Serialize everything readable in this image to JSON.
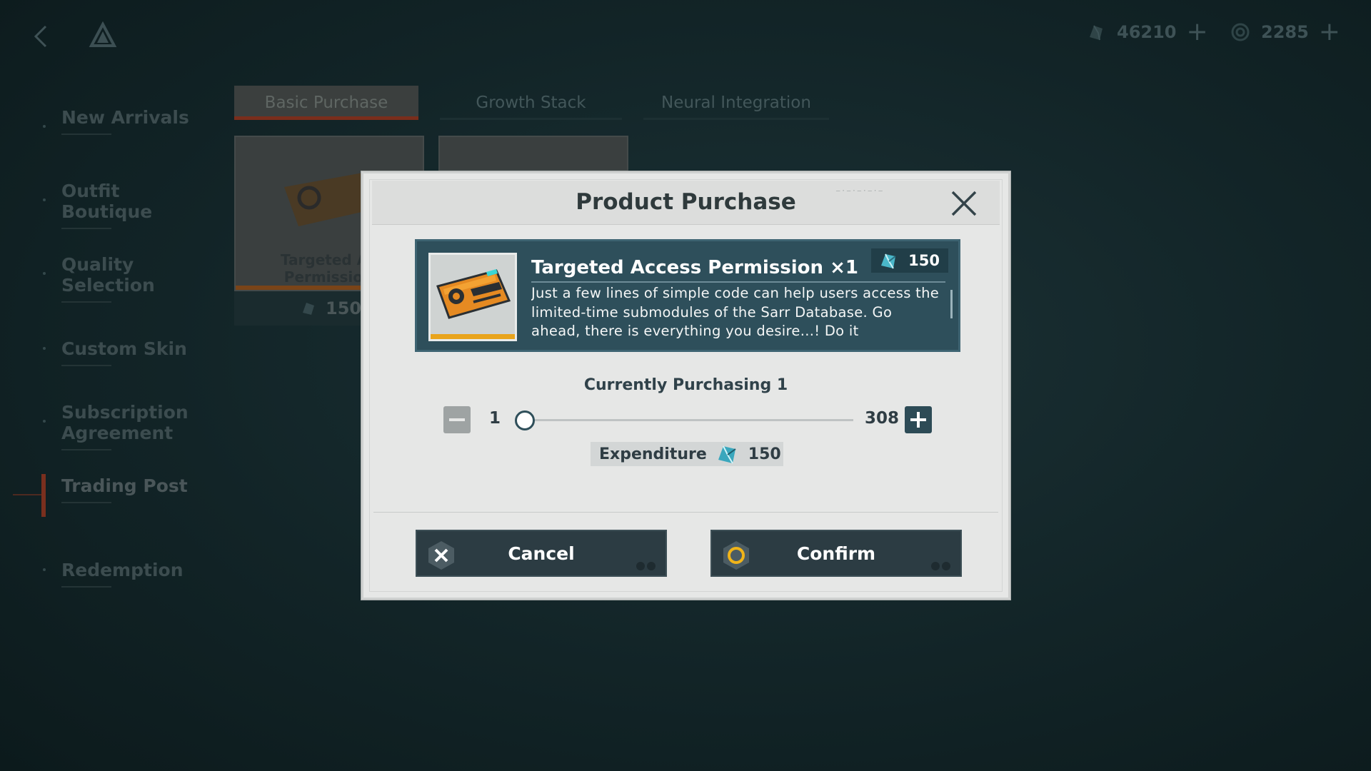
{
  "topbar": {
    "back_icon": "chevron-left-icon",
    "logo_icon": "triangle-logo-icon",
    "currencies": [
      {
        "icon": "crystal-currency-icon",
        "amount": "46210",
        "add": "+"
      },
      {
        "icon": "spiral-currency-icon",
        "amount": "2285",
        "add": "+"
      }
    ]
  },
  "sidebar": {
    "items": [
      {
        "label": "New Arrivals"
      },
      {
        "label": "Outfit Boutique"
      },
      {
        "label": "Quality Selection"
      },
      {
        "label": "Custom Skin"
      },
      {
        "label": "Subscription Agreement"
      },
      {
        "label": "Trading Post",
        "active": true
      },
      {
        "label": "Redemption"
      }
    ]
  },
  "tabs": [
    {
      "label": "Basic Purchase",
      "active": true
    },
    {
      "label": "Growth Stack"
    },
    {
      "label": "Neural Integration"
    }
  ],
  "background_card": {
    "label": "Targeted Ac\nPermission",
    "price": "150"
  },
  "modal": {
    "title": "Product Purchase",
    "close_icon": "close-icon",
    "item": {
      "name": "Targeted Access Permission ×1",
      "price": "150",
      "description": "Just a few lines of simple code can help users access the limited-time submodules of the Sarr Database. Go ahead, there is everything you desire...! Do it"
    },
    "purchasing_label": "Currently Purchasing 1",
    "quantity": {
      "min": "1",
      "max": "308",
      "current": 1
    },
    "expenditure": {
      "label": "Expenditure",
      "amount": "150"
    },
    "buttons": {
      "cancel": "Cancel",
      "confirm": "Confirm"
    }
  },
  "colors": {
    "accent_orange": "#e9a41c",
    "panel_teal": "#2e4f5b",
    "button_dark": "#2c3c43",
    "active_tab_marker": "#7a2e1c"
  }
}
